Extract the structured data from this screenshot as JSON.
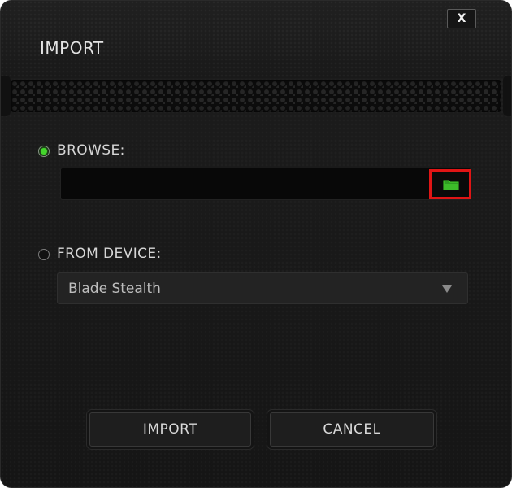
{
  "dialog": {
    "title": "IMPORT",
    "close_label": "X"
  },
  "browse": {
    "label": "BROWSE:",
    "selected": true,
    "path_value": "",
    "folder_icon": "folder-icon",
    "accent_color": "#44d62c",
    "highlight_color": "#e01515"
  },
  "from_device": {
    "label": "FROM DEVICE:",
    "selected": false,
    "device_value": "Blade Stealth",
    "dropdown_icon": "chevron-down-icon"
  },
  "buttons": {
    "import_label": "IMPORT",
    "cancel_label": "CANCEL"
  }
}
